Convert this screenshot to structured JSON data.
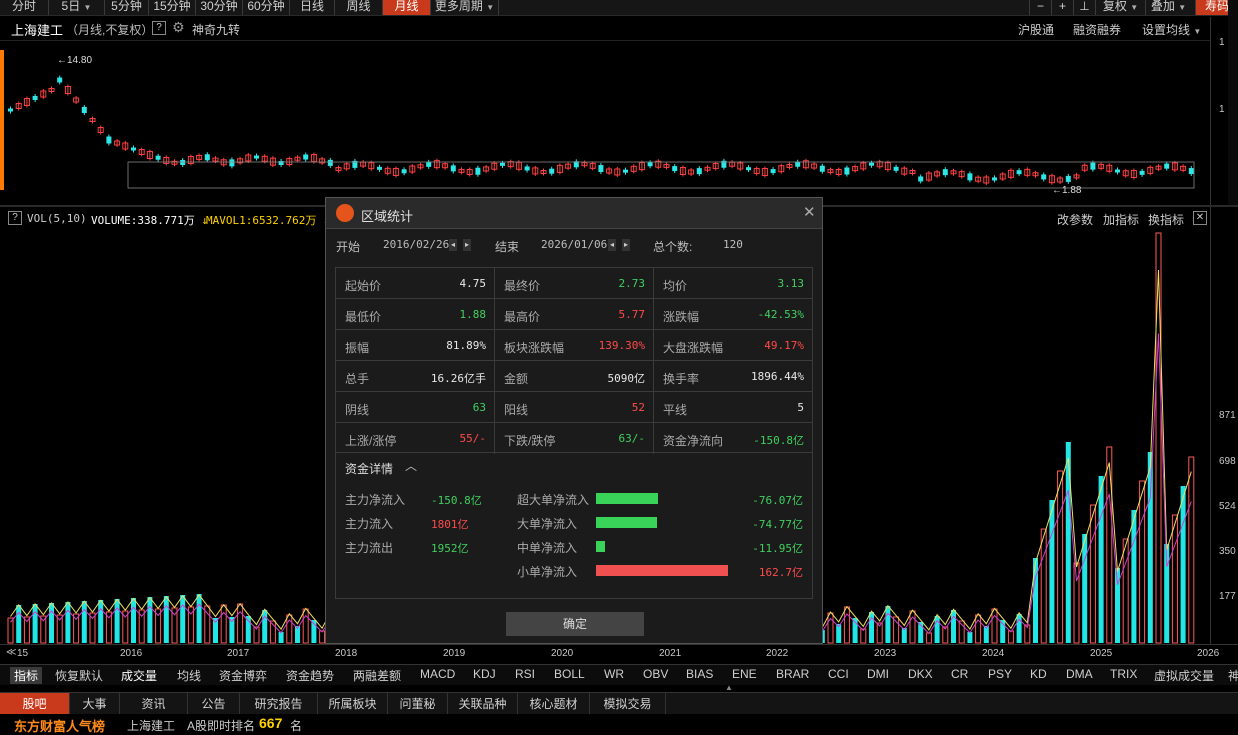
{
  "toolbar": {
    "periods": [
      "分时",
      "5日",
      "5分钟",
      "15分钟",
      "30分钟",
      "60分钟",
      "日线",
      "周线",
      "月线",
      "更多周期"
    ],
    "active_period": "月线",
    "right_items": [
      "复权",
      "叠加"
    ],
    "hotkey": "寿码"
  },
  "header": {
    "stock_name": "上海建工",
    "subtitle": "（月线,不复权）",
    "help": "?",
    "indicator": "神奇九转",
    "right_links": [
      "沪股通",
      "融资融券",
      "设置均线"
    ]
  },
  "kline": {
    "high_label": "14.80",
    "low_label": "1.88",
    "axis_right": [
      "1",
      "1"
    ],
    "nine_turn_labels": [
      "1",
      "2",
      "3",
      "4",
      "5",
      "6",
      "7",
      "8",
      "9"
    ]
  },
  "volume": {
    "header": "VOL(5,10)",
    "volume_label": "VOLUME:338.771万",
    "ma_label": "MAVOL1:6532.762万",
    "tools": [
      "改参数",
      "加指标",
      "换指标"
    ],
    "axis": [
      "871",
      "698",
      "524",
      "350",
      "177"
    ],
    "bars": [
      {
        "h": 0.09,
        "c": "r"
      },
      {
        "h": 0.07,
        "c": "r"
      },
      {
        "h": 0.1,
        "c": "r"
      },
      {
        "h": 0.12,
        "c": "c"
      },
      {
        "h": 0.08,
        "c": "r"
      },
      {
        "h": 0.13,
        "c": "c"
      },
      {
        "h": 0.11,
        "c": "c"
      },
      {
        "h": 0.09,
        "c": "c"
      },
      {
        "h": 0.07,
        "c": "c"
      },
      {
        "h": 0.06,
        "c": "r"
      }
    ]
  },
  "time_axis": [
    "15",
    "2016",
    "2017",
    "2018",
    "2019",
    "2020",
    "2021",
    "2022",
    "2023",
    "2024",
    "2025",
    "2026"
  ],
  "indicators": [
    "指标",
    "恢复默认",
    "成交量",
    "均线",
    "资金博弈",
    "资金趋势",
    "两融差额",
    "MACD",
    "KDJ",
    "RSI",
    "BOLL",
    "WR",
    "OBV",
    "BIAS",
    "ENE",
    "BRAR",
    "CCI",
    "DMI",
    "DKX",
    "CR",
    "PSY",
    "KD",
    "DMA",
    "TRIX",
    "虚拟成交量",
    "神"
  ],
  "bottom_tabs": [
    "股吧",
    "大事",
    "资讯",
    "公告",
    "研究报告",
    "所属板块",
    "问董秘",
    "关联品种",
    "核心题材",
    "模拟交易"
  ],
  "rank": {
    "brand": "东方财富人气榜",
    "stock": "上海建工",
    "label": "A股即时排名",
    "value": "667",
    "unit": "名"
  },
  "modal": {
    "title": "区域统计",
    "start_label": "开始",
    "start_date": "2016/02/26",
    "end_label": "结束",
    "end_date": "2026/01/06",
    "count_label": "总个数:",
    "count": "120",
    "stats": [
      {
        "label": "起始价",
        "value": "4.75",
        "color": "white"
      },
      {
        "label": "最终价",
        "value": "2.73",
        "color": "green"
      },
      {
        "label": "均价",
        "value": "3.13",
        "color": "green"
      },
      {
        "label": "最低价",
        "value": "1.88",
        "color": "green"
      },
      {
        "label": "最高价",
        "value": "5.77",
        "color": "red"
      },
      {
        "label": "涨跌幅",
        "value": "-42.53%",
        "color": "green"
      },
      {
        "label": "振幅",
        "value": "81.89%",
        "color": "white"
      },
      {
        "label": "板块涨跌幅",
        "value": "139.30%",
        "color": "red"
      },
      {
        "label": "大盘涨跌幅",
        "value": "49.17%",
        "color": "red"
      },
      {
        "label": "总手",
        "value": "16.26亿手",
        "color": "white"
      },
      {
        "label": "金额",
        "value": "5090亿",
        "color": "white"
      },
      {
        "label": "换手率",
        "value": "1896.44%",
        "color": "white"
      },
      {
        "label": "阴线",
        "value": "63",
        "color": "green"
      },
      {
        "label": "阳线",
        "value": "52",
        "color": "red"
      },
      {
        "label": "平线",
        "value": "5",
        "color": "white"
      },
      {
        "label": "上涨/涨停",
        "value": "55/-",
        "color": "red"
      },
      {
        "label": "下跌/跌停",
        "value": "63/-",
        "color": "green"
      },
      {
        "label": "资金净流向",
        "value": "-150.8亿",
        "color": "green"
      }
    ],
    "fund_title": "资金详情",
    "fund_left": [
      {
        "label": "主力净流入",
        "value": "-150.8亿",
        "color": "green"
      },
      {
        "label": "主力流入",
        "value": "1801亿",
        "color": "red"
      },
      {
        "label": "主力流出",
        "value": "1952亿",
        "color": "green"
      }
    ],
    "fund_right": [
      {
        "label": "超大单净流入",
        "value": "-76.07亿",
        "color": "green",
        "bar": 0.47,
        "bar_color": "#3ad35a"
      },
      {
        "label": "大单净流入",
        "value": "-74.77亿",
        "color": "green",
        "bar": 0.46,
        "bar_color": "#3ad35a"
      },
      {
        "label": "中单净流入",
        "value": "-11.95亿",
        "color": "green",
        "bar": 0.07,
        "bar_color": "#3ad35a"
      },
      {
        "label": "小单净流入",
        "value": "162.7亿",
        "color": "red",
        "bar": 1.0,
        "bar_color": "#f05050"
      }
    ],
    "ok": "确定"
  }
}
